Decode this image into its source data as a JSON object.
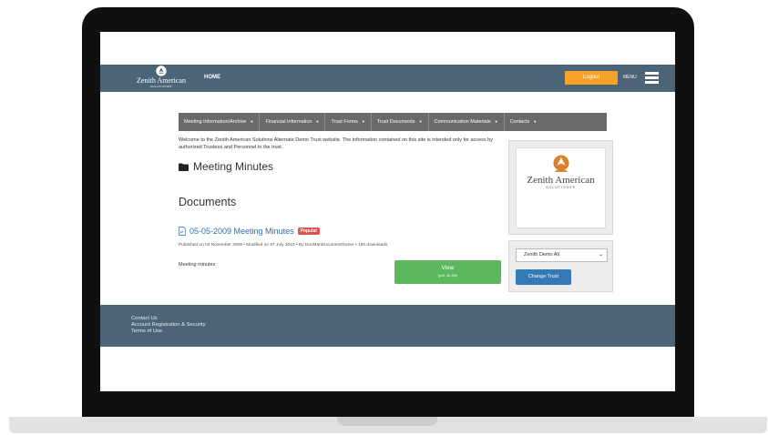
{
  "header": {
    "logo_text": "Zenith American",
    "logo_sub": "SOLUTIONS®",
    "home_label": "HOME",
    "logout_label": "Logout",
    "menu_label": "MENU"
  },
  "nav": {
    "items": [
      {
        "label": "Meeting Information/Archive"
      },
      {
        "label": "Financial Information"
      },
      {
        "label": "Trust Forms"
      },
      {
        "label": "Trust Documents"
      },
      {
        "label": "Communication Materials"
      },
      {
        "label": "Contacts"
      }
    ]
  },
  "main": {
    "welcome_text": "Welcome to the Zenith American Solutions Alternate Demo Trust website. The information contained on this site is intended only for access by authorized Trustees and Personnel to the trust.",
    "folder_title": "Meeting Minutes",
    "documents_heading": "Documents",
    "document": {
      "title": "05-05-2009 Meeting Minutes",
      "badge": "Popular",
      "meta": "Published on 04 November 2009 • Modified on 07 July 2010 • By DocManDocumentOwner • 165 downloads",
      "description": "Meeting minutes",
      "view_label": "View",
      "view_sub": "(pdf, 10 KB)"
    }
  },
  "sidebar": {
    "logo_text": "Zenith American",
    "logo_sub": "SOLUTIONS®",
    "trust_selected": "Zenith Demo Alt",
    "change_trust_label": "Change Trust"
  },
  "footer": {
    "links": [
      {
        "label": "Contact Us"
      },
      {
        "label": "Account Registration & Security"
      },
      {
        "label": "Terms of Use"
      }
    ]
  },
  "colors": {
    "header_bg": "#4b6478",
    "logout_bg": "#f7a128",
    "view_bg": "#5cb85c",
    "change_trust_bg": "#337ab7",
    "badge_bg": "#d9534f",
    "link": "#2a6fb5"
  }
}
